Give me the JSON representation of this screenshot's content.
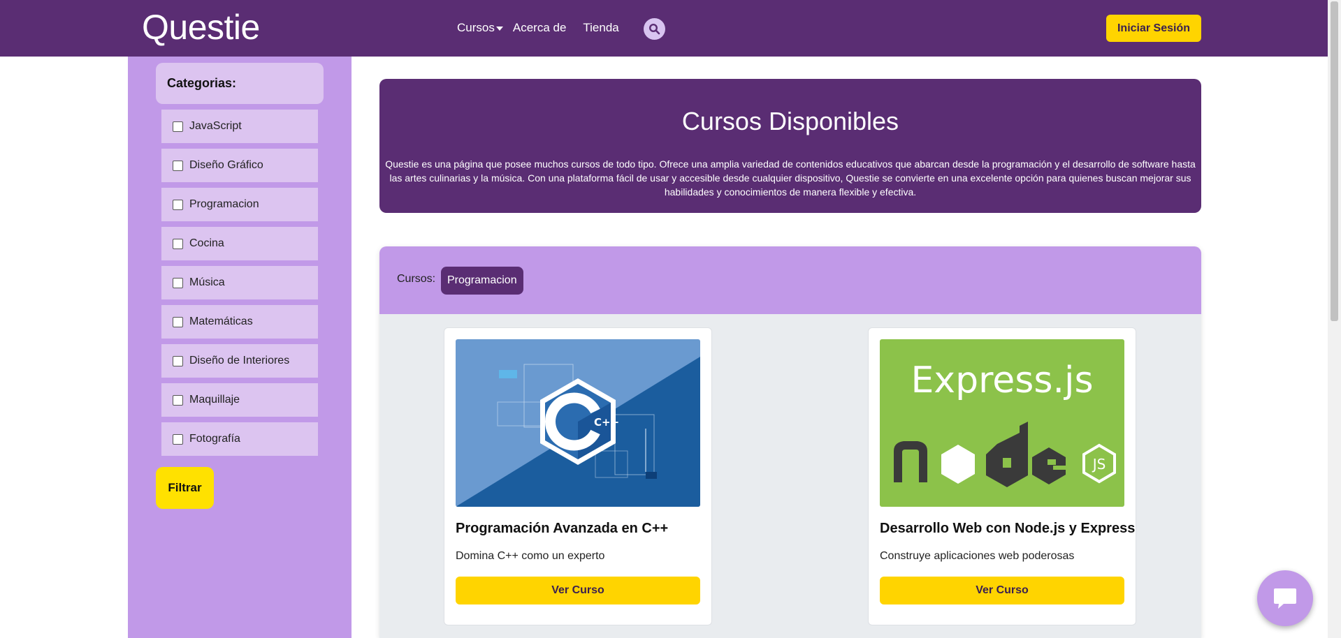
{
  "header": {
    "logo": "Questie",
    "nav": [
      {
        "label": "Cursos",
        "has_dropdown": true
      },
      {
        "label": "Acerca de"
      },
      {
        "label": "Tienda"
      }
    ],
    "search_icon": "search-icon",
    "login_label": "Iniciar Sesión"
  },
  "sidebar": {
    "title": "Categorias:",
    "categories": [
      {
        "label": "JavaScript",
        "checked": false
      },
      {
        "label": "Diseño Gráfico",
        "checked": false
      },
      {
        "label": "Programacion",
        "checked": false
      },
      {
        "label": "Cocina",
        "checked": false
      },
      {
        "label": "Música",
        "checked": false
      },
      {
        "label": "Matemáticas",
        "checked": false
      },
      {
        "label": "Diseño de Interiores",
        "checked": false
      },
      {
        "label": "Maquillaje",
        "checked": false
      },
      {
        "label": "Fotografía",
        "checked": false
      }
    ],
    "filter_label": "Filtrar"
  },
  "hero": {
    "title": "Cursos Disponibles",
    "description": "Questie es una página que posee muchos cursos de todo tipo. Ofrece una amplia variedad de contenidos educativos que abarcan desde la programación y el desarrollo de software hasta las artes culinarias y la música. Con una plataforma fácil de usar y accesible desde cualquier dispositivo, Questie se convierte en una excelente opción para quienes buscan mejorar sus habilidades y conocimientos de manera flexible y efectiva."
  },
  "courses": {
    "label": "Cursos:",
    "active_tag": "Programacion",
    "items": [
      {
        "image_text": "C++",
        "title": "Programación Avanzada en C++",
        "description": "Domina C++ como un experto",
        "button": "Ver Curso"
      },
      {
        "image_text": "Express.js",
        "title": "Desarrollo Web con Node.js y Express",
        "description": "Construye aplicaciones web poderosas",
        "button": "Ver Curso"
      }
    ]
  },
  "chat": {
    "icon": "chat-bubble-icon"
  },
  "colors": {
    "brand_purple": "#5a2d73",
    "light_purple": "#c199e8",
    "pale_purple": "#dcc4f0",
    "accent_yellow": "#ffd400",
    "express_green": "#8cc24a",
    "cpp_blue": "#1b5d9e"
  }
}
